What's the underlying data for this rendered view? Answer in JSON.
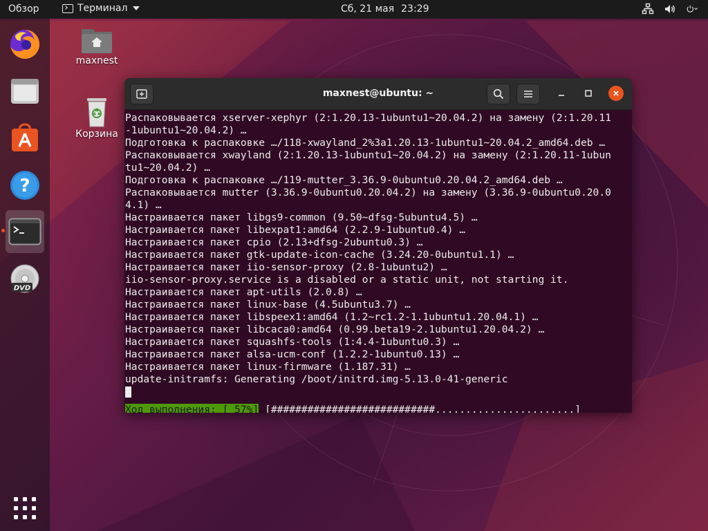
{
  "topbar": {
    "overview_label": "Обзор",
    "app_name": "Терминал",
    "date": "Сб, 21 мая",
    "time": "23:29",
    "tray_icons": [
      "network-icon",
      "volume-icon",
      "power-icon"
    ]
  },
  "dock": {
    "items": [
      {
        "name": "firefox-icon"
      },
      {
        "name": "files-icon"
      },
      {
        "name": "software-icon"
      },
      {
        "name": "help-icon"
      },
      {
        "name": "terminal-icon",
        "active": true
      },
      {
        "name": "dvd-icon"
      },
      {
        "name": "app-grid-icon"
      }
    ]
  },
  "desktop": {
    "home_label": "maxnest",
    "trash_label": "Корзина"
  },
  "terminal": {
    "title": "maxnest@ubuntu: ~",
    "lines": [
      "Распаковывается xserver-xephyr (2:1.20.13-1ubuntu1~20.04.2) на замену (2:1.20.11",
      "-1ubuntu1~20.04.2) …",
      "Подготовка к распаковке …/118-xwayland_2%3a1.20.13-1ubuntu1~20.04.2_amd64.deb …",
      "Распаковывается xwayland (2:1.20.13-1ubuntu1~20.04.2) на замену (2:1.20.11-1ubun",
      "tu1~20.04.2) …",
      "Подготовка к распаковке …/119-mutter_3.36.9-0ubuntu0.20.04.2_amd64.deb …",
      "Распаковывается mutter (3.36.9-0ubuntu0.20.04.2) на замену (3.36.9-0ubuntu0.20.0",
      "4.1) …",
      "Настраивается пакет libgs9-common (9.50~dfsg-5ubuntu4.5) …",
      "Настраивается пакет libexpat1:amd64 (2.2.9-1ubuntu0.4) …",
      "Настраивается пакет cpio (2.13+dfsg-2ubuntu0.3) …",
      "Настраивается пакет gtk-update-icon-cache (3.24.20-0ubuntu1.1) …",
      "Настраивается пакет iio-sensor-proxy (2.8-1ubuntu2) …",
      "iio-sensor-proxy.service is a disabled or a static unit, not starting it.",
      "Настраивается пакет apt-utils (2.0.8) …",
      "Настраивается пакет linux-base (4.5ubuntu3.7) …",
      "Настраивается пакет libspeex1:amd64 (1.2~rc1.2-1.1ubuntu1.20.04.1) …",
      "Настраивается пакет libcaca0:amd64 (0.99.beta19-2.1ubuntu1.20.04.2) …",
      "Настраивается пакет squashfs-tools (1:4.4-1ubuntu0.3) …",
      "Настраивается пакет alsa-ucm-conf (1.2.2-1ubuntu0.13) …",
      "Настраивается пакет linux-firmware (1.187.31) …",
      "update-initramfs: Generating /boot/initrd.img-5.13.0-41-generic"
    ],
    "progress_label": "Ход выполнения: [ 57%]",
    "progress_bar": "[###########################.......................]",
    "progress_percent": 57
  },
  "colors": {
    "terminal_bg": "#300a24",
    "accent": "#e95420",
    "progress_green": "#4e9a06"
  }
}
